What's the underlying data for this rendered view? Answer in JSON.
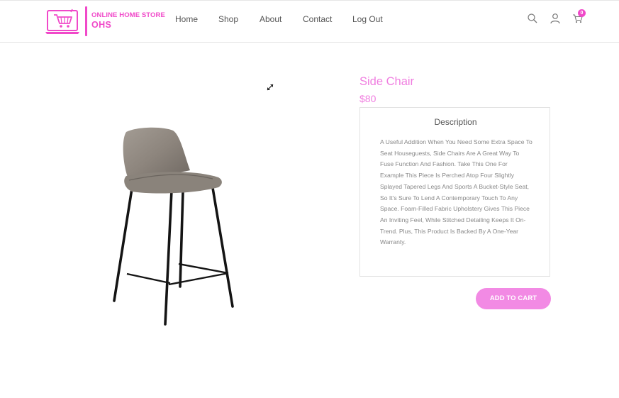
{
  "brand": {
    "line1": "ONLINE HOME STORE",
    "line2": "OHS",
    "accent_color": "#f049c9",
    "icon": "shopping-cart-laptop-logo"
  },
  "nav": {
    "items": [
      {
        "label": "Home"
      },
      {
        "label": "Shop"
      },
      {
        "label": "About"
      },
      {
        "label": "Contact"
      },
      {
        "label": "Log Out"
      }
    ]
  },
  "header_icons": {
    "search": "search-icon",
    "user": "user-icon",
    "cart": "cart-icon",
    "cart_count": "0"
  },
  "product": {
    "title": "Side Chair",
    "price": "$80",
    "title_color": "#f07ee0",
    "image": "side-chair-image",
    "description_heading": "Description",
    "description": "A Useful Addition When You Need Some Extra Space To Seat Houseguests, Side Chairs Are A Great Way To Fuse Function And Fashion. Take This One For Example This Piece Is Perched Atop Four Slightly Splayed Tapered Legs And Sports A Bucket-Style Seat, So It's Sure To Lend A Contemporary Touch To Any Space. Foam-Filled Fabric Upholstery Gives This Piece An Inviting Feel, While Stitched Detailing Keeps It On-Trend. Plus, This Product Is Backed By A One-Year Warranty.",
    "add_to_cart_label": "ADD TO CART",
    "button_color": "#f28ae4"
  }
}
